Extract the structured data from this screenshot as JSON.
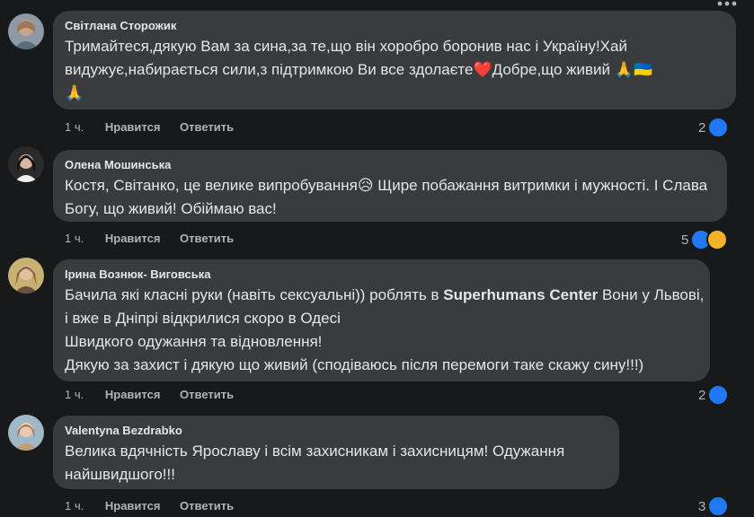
{
  "comments": [
    {
      "author": "Світлана Сторожик",
      "text_parts": [
        "Тримайтеся,дякую Вам за сина,за те,що він хоробро боронив нас і Україну!Хай видужує,набирається сили,з підтримкою Ви все здолаєте",
        "❤️",
        "Добре,що живий ",
        "🙏",
        "🇺🇦",
        "🙏"
      ],
      "time": "1 ч.",
      "like_label": "Нравится",
      "reply_label": "Ответить",
      "reaction_count": "2"
    },
    {
      "author": "Олена Мошинська",
      "text_parts": [
        "Костя, Світанко, це велике випробування",
        "😥",
        " Щире побажання витримки і мужності. І Слава Богу, що живий! Обіймаю вас!"
      ],
      "time": "1 ч.",
      "like_label": "Нравится",
      "reply_label": "Ответить",
      "reaction_count": "5"
    },
    {
      "author": "Ірина Вознюк- Виговська",
      "text_line1": "Бачила які класні руки (навіть сексуальні)) роблять в ",
      "text_bold": "Superhumans Center",
      "text_line1b": " Вони у Львові, і вже в Дніпрі відкрилися скоро в Одесі",
      "text_line2": "Швидкого одужання та відновлення!",
      "text_line3": "Дякую за захист і дякую що живий (сподіваюсь після перемоги таке скажу сину!!!)",
      "time": "1 ч.",
      "like_label": "Нравится",
      "reply_label": "Ответить",
      "reaction_count": "2"
    },
    {
      "author": "Valentyna Bezdrabko",
      "text": "Велика вдячність Ярославу і всім захисникам і захисницям! Одужання найшвидшого!!!",
      "time": "1 ч.",
      "like_label": "Нравится",
      "reply_label": "Ответить",
      "reaction_count": "3"
    }
  ],
  "colors": {
    "bg": "#18191a",
    "bubble": "#3a3b3c",
    "like": "#2078f4",
    "care": "#f7b125"
  }
}
